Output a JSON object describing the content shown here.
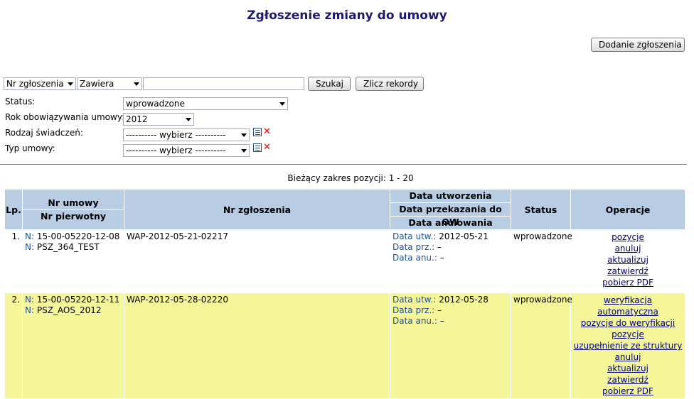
{
  "page": {
    "title": "Zgłoszenie zmiany do umowy"
  },
  "actions": {
    "add_label": "Dodanie zgłoszenia"
  },
  "search": {
    "field_select": "Nr zgłoszenia",
    "mode_select": "Zawiera",
    "query_value": "",
    "search_label": "Szukaj",
    "count_label": "Zlicz rekordy"
  },
  "filters": {
    "status_label": "Status:",
    "status_value": "wprowadzone",
    "year_label": "Rok obowiązywania umowy:",
    "year_value": "2012",
    "benefit_label": "Rodzaj świadczeń:",
    "benefit_value": "---------- wybierz ----------",
    "contract_type_label": "Typ umowy:",
    "contract_type_value": "---------- wybierz ----------"
  },
  "range_text": "Bieżący zakres pozycji: 1 - 20",
  "table": {
    "headers": {
      "lp": "Lp.",
      "contract_no": "Nr umowy",
      "original_no": "Nr pierwotny",
      "report_no": "Nr zgłoszenia",
      "created": "Data utworzenia",
      "transferred": "Data przekazania do OW",
      "cancelled": "Data anulowania",
      "status": "Status",
      "operations": "Operacje"
    },
    "rows": [
      {
        "lp": "1.",
        "n1_key": "N:",
        "n1_val": "15-00-05220-12-08",
        "n2_key": "N:",
        "n2_val": "PSZ_364_TEST",
        "report_no": "WAP-2012-05-21-02217",
        "d1_key": "Data utw.:",
        "d1_val": "2012-05-21",
        "d2_key": "Data prz.:",
        "d2_val": "–",
        "d3_key": "Data anu.:",
        "d3_val": "–",
        "status": "wprowadzone",
        "ops": [
          "pozycje",
          "anuluj",
          "aktualizuj",
          "zatwierdź",
          "pobierz PDF"
        ]
      },
      {
        "lp": "2.",
        "n1_key": "N:",
        "n1_val": "15-00-05220-12-11",
        "n2_key": "N:",
        "n2_val": "PSZ_AOS_2012",
        "report_no": "WAP-2012-05-28-02220",
        "d1_key": "Data utw.:",
        "d1_val": "2012-05-28",
        "d2_key": "Data prz.:",
        "d2_val": "–",
        "d3_key": "Data anu.:",
        "d3_val": "–",
        "status": "wprowadzone",
        "ops": [
          "weryfikacja automatyczna",
          "pozycje do weryfikacji",
          "pozycje",
          "uzupełnienie ze struktury",
          "anuluj",
          "aktualizuj",
          "zatwierdź",
          "pobierz PDF"
        ]
      }
    ]
  }
}
